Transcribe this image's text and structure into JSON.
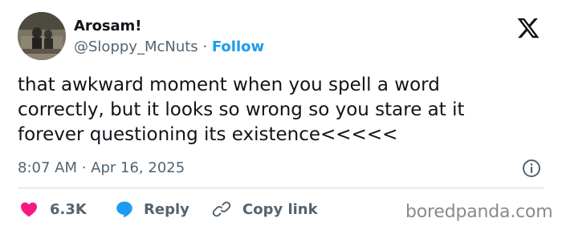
{
  "author": {
    "display_name": "Arosam!",
    "handle": "@Sloppy_McNuts",
    "separator": " · ",
    "follow_label": "Follow"
  },
  "tweet": {
    "text_lines": [
      "that awkward moment when you spell a word",
      "correctly, but it looks so wrong so you stare at it",
      "forever questioning its existence<<<<<"
    ],
    "timestamp": "8:07 AM · Apr 16, 2025"
  },
  "actions": {
    "like_count": "6.3K",
    "reply_label": "Reply",
    "copy_link_label": "Copy link"
  },
  "watermark": "boredpanda.com",
  "colors": {
    "text": "#0f1419",
    "secondary": "#536471",
    "accent": "#1d9bf0",
    "like": "#f91880",
    "divider": "#cfd9de"
  },
  "icons": {
    "platform": "x-logo-icon",
    "info": "info-icon",
    "like": "heart-icon",
    "reply": "speech-bubble-icon",
    "copy": "link-icon"
  }
}
